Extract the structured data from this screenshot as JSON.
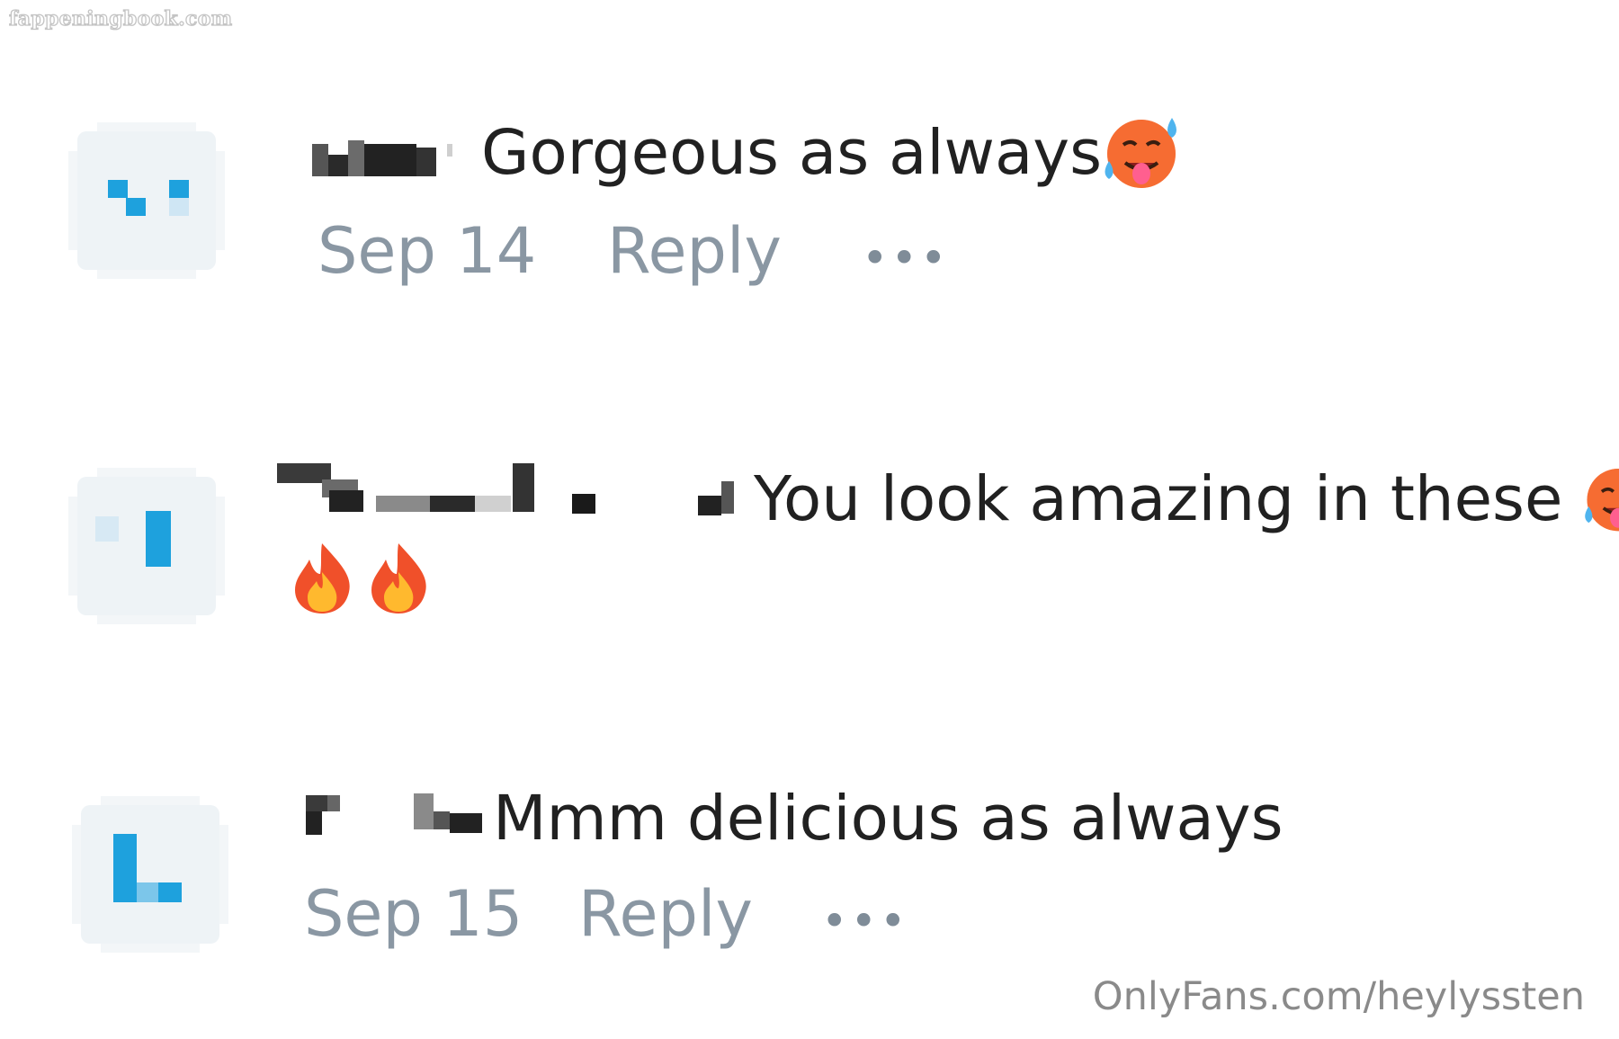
{
  "watermarks": {
    "top": "fappeningbook.com",
    "bottom": "OnlyFans.com/heylyssten"
  },
  "comments": [
    {
      "text": "Gorgeous as always",
      "emoji": "hot-face",
      "date": "Sep 14",
      "reply_label": "Reply",
      "more_label": "•••"
    },
    {
      "text": "You look amazing in these",
      "emoji": "hot-face",
      "trailing_emoji": [
        "fire",
        "fire"
      ]
    },
    {
      "text": "Mmm delicious as always",
      "date": "Sep 15",
      "reply_label": "Reply",
      "more_label": "•••"
    }
  ],
  "colors": {
    "meta_text": "#8a97a3",
    "avatar_bg": "#eef3f6",
    "avatar_accent": "#1ea1dd",
    "comment_text": "#212121"
  }
}
